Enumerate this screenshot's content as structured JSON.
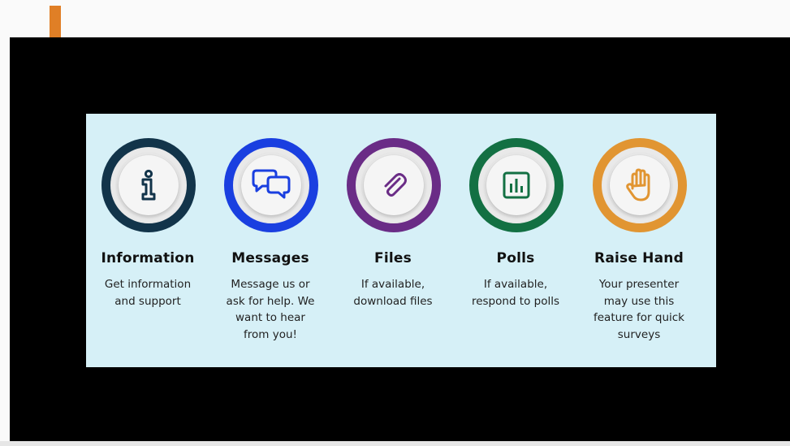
{
  "colors": {
    "arrow": "#e07f26",
    "stage_background": "#000000",
    "panel_background": "#d6f0f7",
    "information_ring": "#12344a",
    "messages_ring": "#1a3fe0",
    "files_ring": "#6a2c86",
    "polls_ring": "#137043",
    "raise_hand_ring": "#e19532"
  },
  "features": [
    {
      "title": "Information",
      "description": "Get information\nand support",
      "icon": "info-icon"
    },
    {
      "title": "Messages",
      "description": "Message us or\nask for help.  We\nwant to hear\nfrom you!",
      "icon": "chat-bubbles-icon"
    },
    {
      "title": "Files",
      "description": "If available,\ndownload files",
      "icon": "paperclip-icon"
    },
    {
      "title": "Polls",
      "description": "If available,\nrespond to polls",
      "icon": "bar-chart-icon"
    },
    {
      "title": "Raise Hand",
      "description": "Your presenter\nmay use this\nfeature for quick\nsurveys",
      "icon": "raised-hand-icon"
    }
  ]
}
